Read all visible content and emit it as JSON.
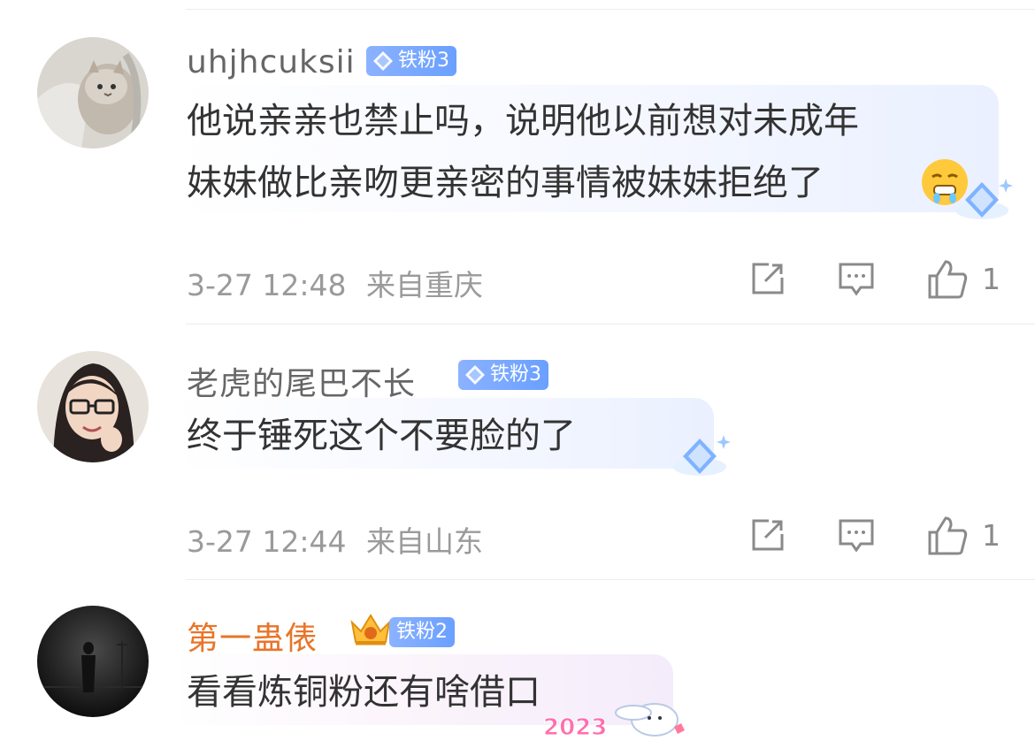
{
  "comments": [
    {
      "username": "uhjhcuksii",
      "badge": "铁粉3",
      "lines": [
        "他说亲亲也禁止吗，说明他以前想对未成年",
        "妹妹做比亲吻更亲密的事情被妹妹拒绝了"
      ],
      "time": "3-27 12:48",
      "location": "来自重庆",
      "likes": "1"
    },
    {
      "username": "老虎的尾巴不长",
      "badge": "铁粉3",
      "lines": [
        "终于锤死这个不要脸的了"
      ],
      "time": "3-27 12:44",
      "location": "来自山东",
      "likes": "1"
    },
    {
      "username": "第一蛊俵",
      "badge": "铁粉2",
      "lines": [
        "看看炼铜粉还有啥借口"
      ],
      "bubble_text": "2023"
    }
  ],
  "icons": {
    "repost": "repost-icon",
    "comment": "comment-icon",
    "like": "thumbs-up-icon",
    "badge": "diamond-icon",
    "crown": "crown-icon"
  },
  "colors": {
    "username": "#666666",
    "username_vip": "#e8752a",
    "badge": "#78a8ff",
    "meta": "#9a9a9a"
  }
}
